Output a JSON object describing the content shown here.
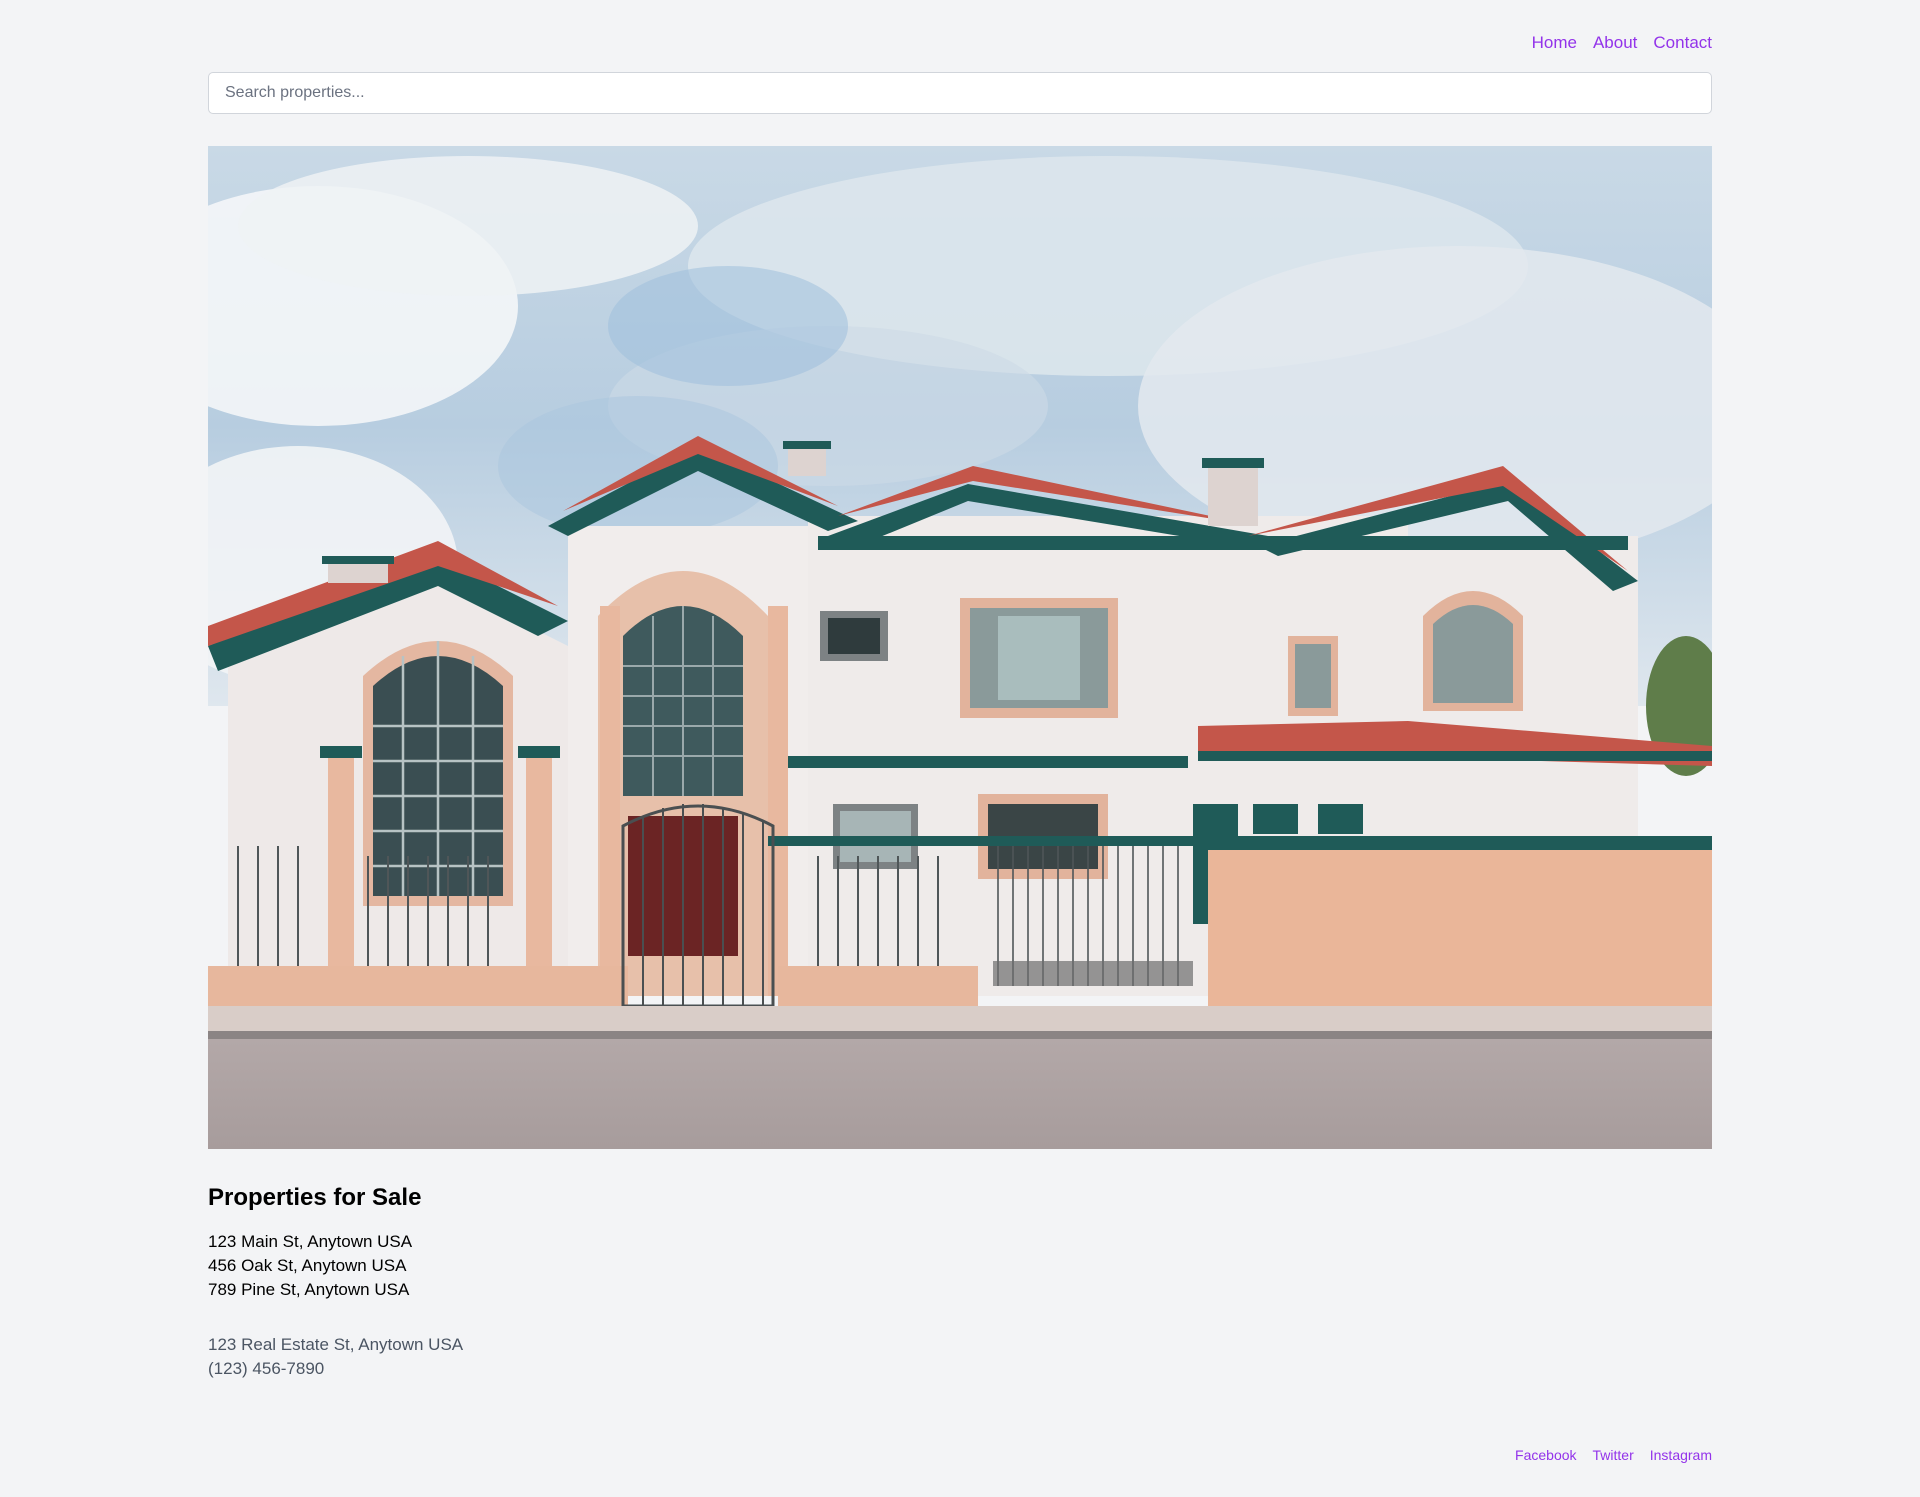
{
  "nav": {
    "links": [
      "Home",
      "About",
      "Contact"
    ]
  },
  "search": {
    "placeholder": "Search properties..."
  },
  "hero": {
    "alt": "Two-story white stucco house with red tile roof, teal trim and peach fence"
  },
  "properties": {
    "heading": "Properties for Sale",
    "items": [
      "123 Main St, Anytown USA",
      "456 Oak St, Anytown USA",
      "789 Pine St, Anytown USA"
    ]
  },
  "contact": {
    "address": "123 Real Estate St, Anytown USA",
    "phone": "(123) 456-7890"
  },
  "social": {
    "links": [
      "Facebook",
      "Twitter",
      "Instagram"
    ]
  },
  "colors": {
    "background": "#f3f4f6",
    "link": "#9333ea",
    "muted_text": "#4b5563"
  }
}
